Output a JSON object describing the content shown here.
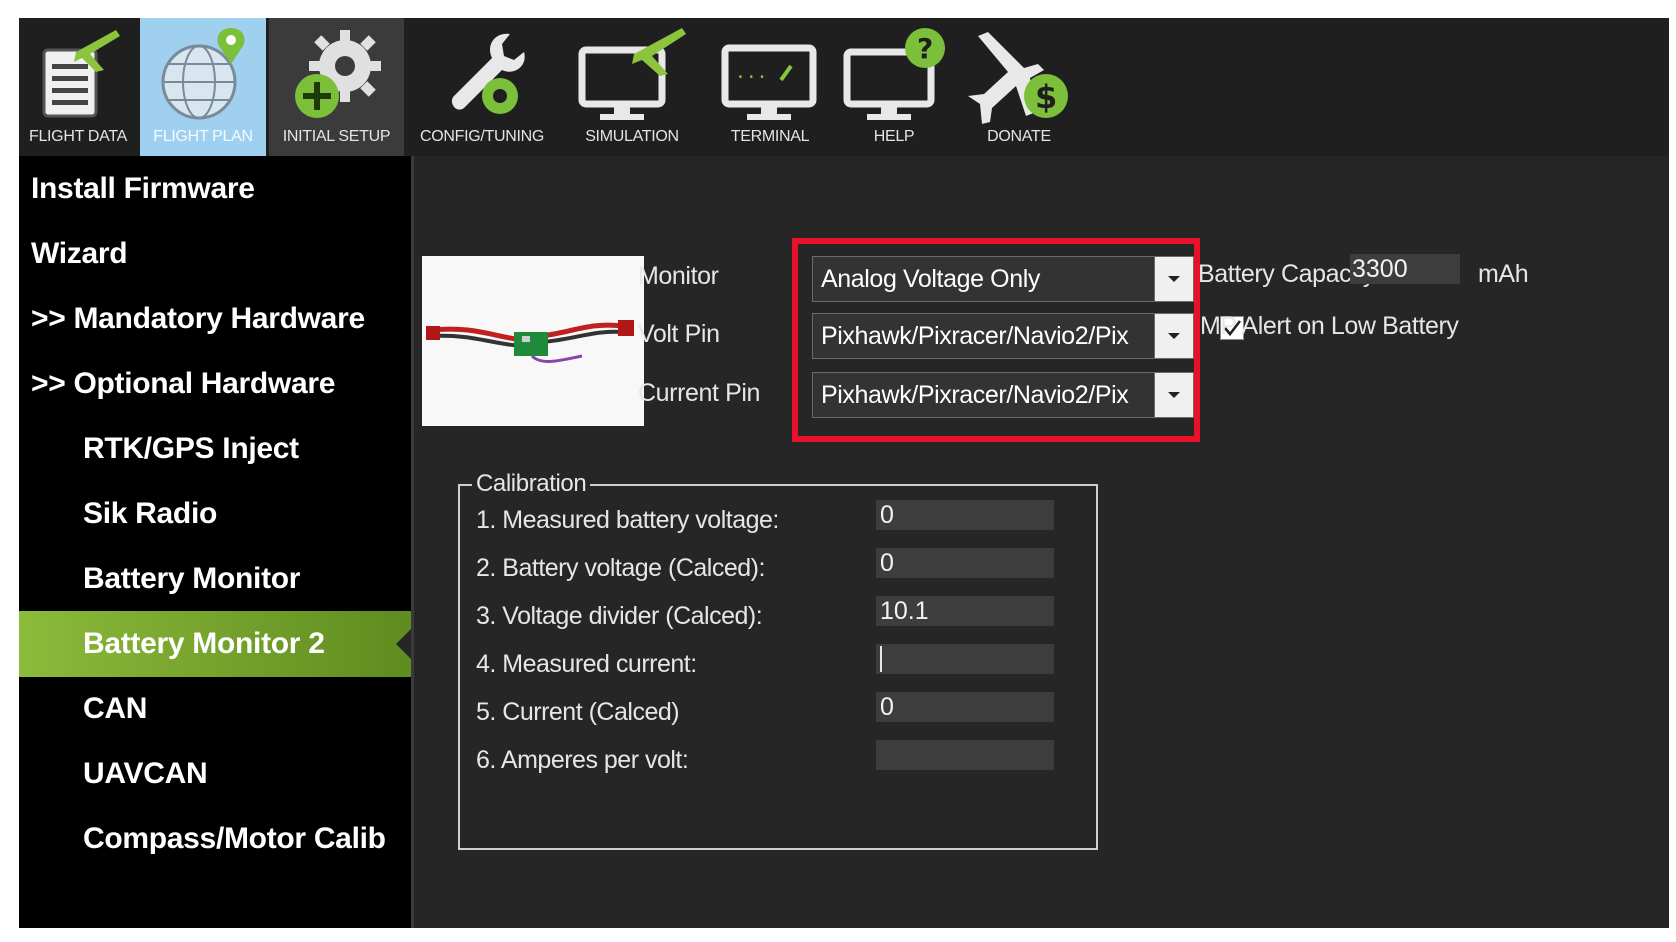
{
  "toolbar": {
    "items": [
      {
        "label": "FLIGHT DATA"
      },
      {
        "label": "FLIGHT PLAN"
      },
      {
        "label": "INITIAL SETUP"
      },
      {
        "label": "CONFIG/TUNING"
      },
      {
        "label": "SIMULATION"
      },
      {
        "label": "TERMINAL"
      },
      {
        "label": "HELP"
      },
      {
        "label": "DONATE"
      }
    ]
  },
  "sidebar": {
    "items": [
      {
        "label": "Install Firmware"
      },
      {
        "label": "Wizard"
      },
      {
        "label": ">> Mandatory Hardware"
      },
      {
        "label": ">> Optional Hardware"
      },
      {
        "label": "RTK/GPS Inject"
      },
      {
        "label": "Sik Radio"
      },
      {
        "label": "Battery Monitor"
      },
      {
        "label": "Battery Monitor 2"
      },
      {
        "label": "CAN"
      },
      {
        "label": "UAVCAN"
      },
      {
        "label": "Compass/Motor Calib"
      }
    ],
    "selected": "Battery Monitor 2"
  },
  "monitor": {
    "monitor_label": "Monitor",
    "monitor_value": "Analog Voltage Only",
    "volt_pin_label": "Volt Pin",
    "volt_pin_value": "Pixhawk/Pixracer/Navio2/Pix",
    "current_pin_label": "Current Pin",
    "current_pin_value": "Pixhawk/Pixracer/Navio2/Pix"
  },
  "battery": {
    "capacity_label": "Battery Capacity",
    "capacity_value": "3300",
    "capacity_unit": "mAh",
    "alert_label": "MP Alert on Low Battery",
    "alert_checked": true
  },
  "calibration": {
    "title": "Calibration",
    "rows": [
      {
        "label": "1. Measured battery voltage:",
        "value": "0"
      },
      {
        "label": "2. Battery voltage (Calced):",
        "value": "0"
      },
      {
        "label": "3. Voltage divider (Calced):",
        "value": "10.1"
      },
      {
        "label": "4. Measured current:",
        "value": ""
      },
      {
        "label": "5. Current (Calced)",
        "value": "0"
      },
      {
        "label": "6. Amperes per volt:",
        "value": ""
      }
    ]
  },
  "colors": {
    "highlight": "#e8102a",
    "selected_nav": "#7aa82e",
    "active_tab": "#9fd0f0"
  }
}
